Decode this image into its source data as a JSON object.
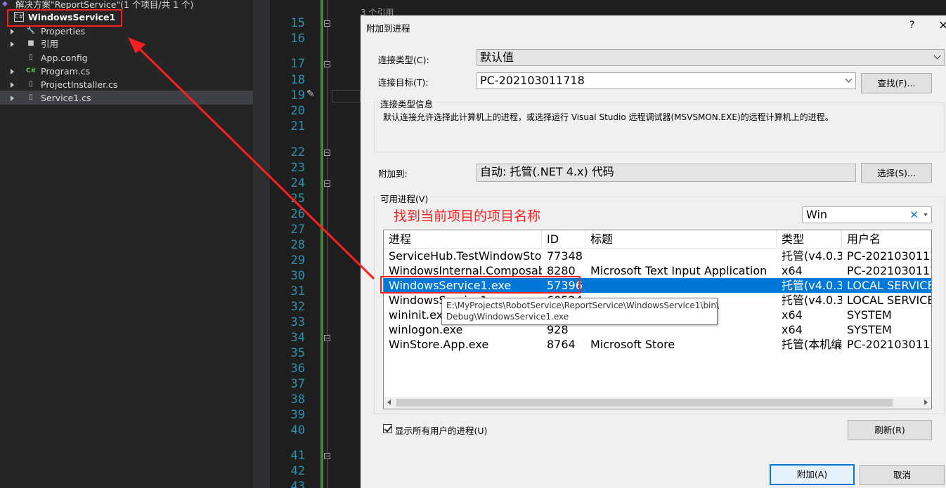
{
  "solution_explorer": {
    "solution_label": "解决方案\"ReportService\"(1 个项目/共 1 个)",
    "project_name": "WindowsService1",
    "project_icon": "C#",
    "items": [
      {
        "label": "Properties",
        "icon": "wrench-icon"
      },
      {
        "label": "引用",
        "icon": "references-icon"
      },
      {
        "label": "App.config",
        "icon": "config-file-icon"
      },
      {
        "label": "Program.cs",
        "icon": "csharp-file-icon"
      },
      {
        "label": "ProjectInstaller.cs",
        "icon": "file-icon"
      },
      {
        "label": "Service1.cs",
        "icon": "file-icon"
      }
    ]
  },
  "editor": {
    "reference_count": "3 个引用",
    "line_numbers": [
      "15",
      "16",
      "17",
      "18",
      "19",
      "20",
      "21",
      "22",
      "23",
      "24",
      "25",
      "26",
      "27",
      "28",
      "29",
      "30",
      "31",
      "32",
      "33",
      "34",
      "35",
      "36",
      "37",
      "38",
      "39",
      "40",
      "41",
      "42",
      "43"
    ]
  },
  "dialog": {
    "title": "附加到进程",
    "help": "?",
    "close": "×",
    "connection_type_label": "连接类型(C):",
    "connection_type_value": "默认值",
    "connection_target_label": "连接目标(T):",
    "connection_target_value": "PC-202103011718",
    "find_button": "查找(F)...",
    "info_group_label": "连接类型信息",
    "info_text": "默认连接允许选择此计算机上的进程，或选择运行 Visual Studio 远程调试器(MSVSMON.EXE)的远程计算机上的进程。",
    "attach_to_label": "附加到:",
    "attach_to_value": "自动: 托管(.NET 4.x) 代码",
    "select_button": "选择(S)...",
    "available_processes_label": "可用进程(V)",
    "filter_value": "Win",
    "columns": [
      "进程",
      "ID",
      "标题",
      "类型",
      "用户名"
    ],
    "rows": [
      {
        "process": "ServiceHub.TestWindowStoreHost.e...",
        "id": "77348",
        "title": "",
        "type": "托管(v4.0.30...",
        "user": "PC-202103011718\\..."
      },
      {
        "process": "WindowsInternal.ComposableShell....",
        "id": "8280",
        "title": "Microsoft Text Input Application",
        "type": "x64",
        "user": "PC-202103011718\\..."
      },
      {
        "process": "WindowsService1.exe",
        "id": "57396",
        "title": "",
        "type": "托管(v4.0.30...",
        "user": "LOCAL SERVICE"
      },
      {
        "process": "WindowsService1...",
        "id": "60524",
        "title": "",
        "type": "托管(v4.0.30...",
        "user": "LOCAL SERVICE"
      },
      {
        "process": "wininit.exe",
        "id": "",
        "title": "",
        "type": "x64",
        "user": "SYSTEM"
      },
      {
        "process": "winlogon.exe",
        "id": "928",
        "title": "",
        "type": "x64",
        "user": "SYSTEM"
      },
      {
        "process": "WinStore.App.exe",
        "id": "8764",
        "title": "Microsoft Store",
        "type": "托管(本机编...",
        "user": "PC-202103011718\\..."
      }
    ],
    "tooltip_line1": "E:\\MyProjects\\RobotService\\ReportService\\WindowsService1\\bin\\",
    "tooltip_line2": "Debug\\WindowsService1.exe",
    "show_all_users_label": "显示所有用户的进程(U)",
    "show_all_users_checked": true,
    "refresh_button": "刷新(R)",
    "attach_button": "附加(A)",
    "cancel_button": "取消"
  },
  "annotation": {
    "text": "找到当前项目的项目名称",
    "color": "#ff1e1e"
  },
  "colors": {
    "selection": "#0078d7",
    "line_number": "#2b91af",
    "annotation_red": "#ff1e1e"
  }
}
